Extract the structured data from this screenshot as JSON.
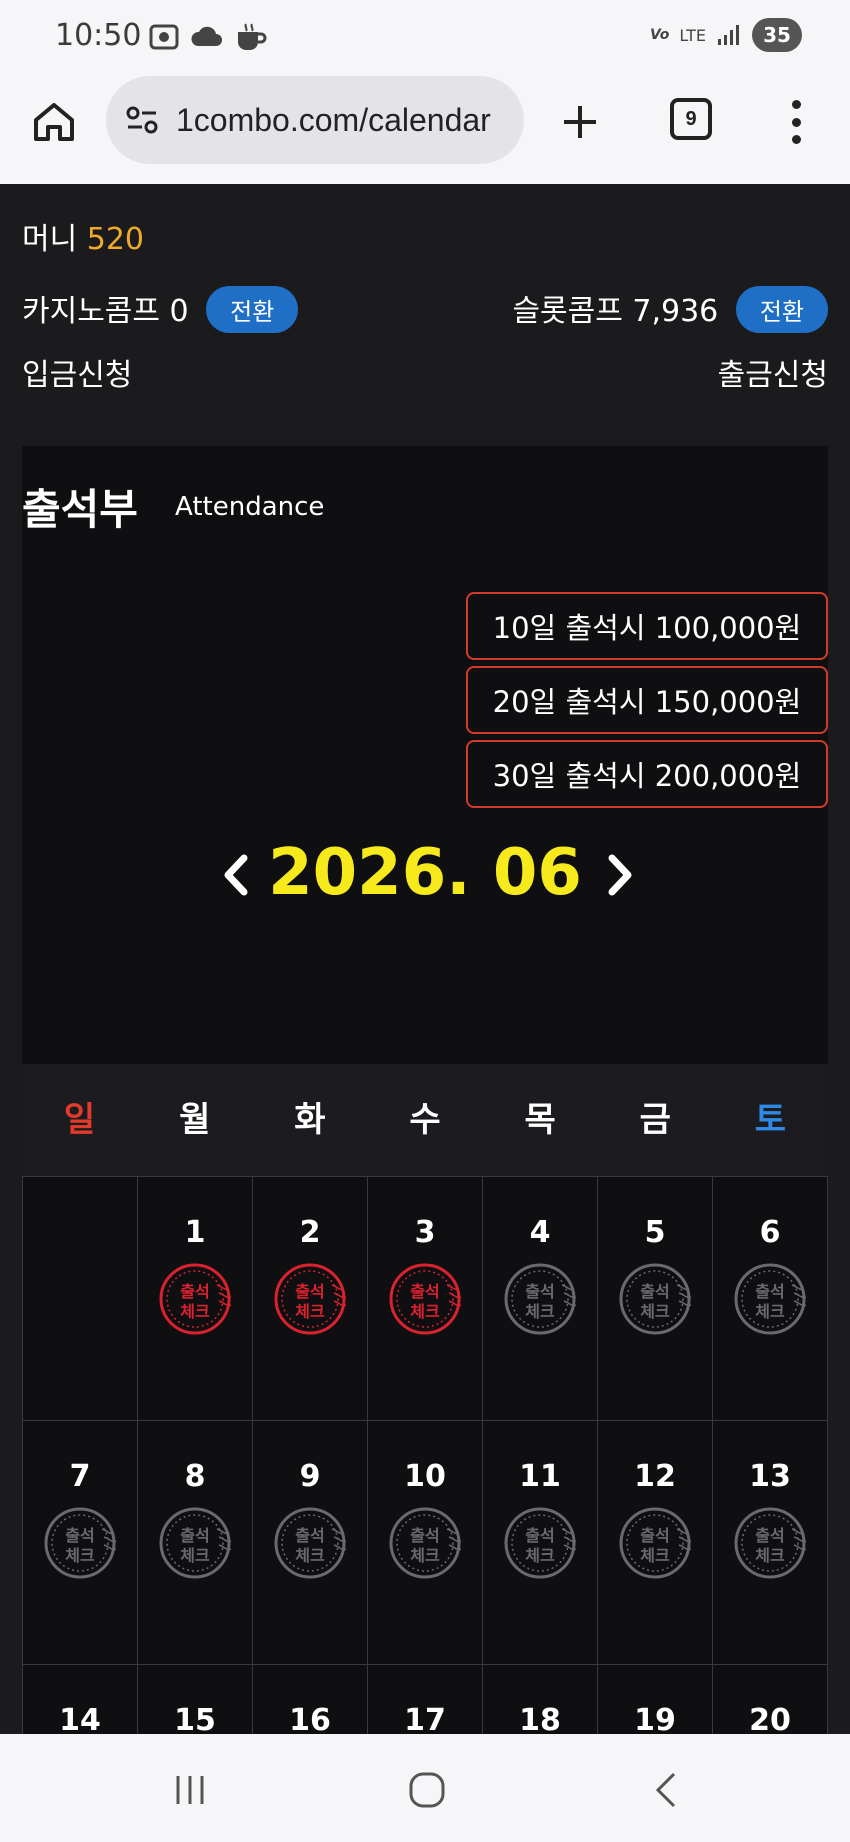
{
  "status_bar": {
    "time": "10:50",
    "network": "LTE",
    "battery": "35"
  },
  "browser": {
    "url": "1combo.com/calendar",
    "tab_count": "9"
  },
  "account": {
    "money_label": "머니",
    "money_value": "520",
    "casino_comp_label": "카지노콤프 0",
    "slot_comp_label": "슬롯콤프 7,936",
    "convert_label": "전환",
    "deposit_label": "입금신청",
    "withdraw_label": "출금신청"
  },
  "attendance": {
    "title": "출석부",
    "subtitle": "Attendance",
    "rewards": [
      "10일 출석시 100,000원",
      "20일 출석시 150,000원",
      "30일 출석시 200,000원"
    ],
    "month": "2026. 06",
    "weekdays": [
      "일",
      "월",
      "화",
      "수",
      "목",
      "금",
      "토"
    ],
    "stamp_text_line1": "출석",
    "stamp_text_line2": "체크",
    "days": [
      {
        "day": "",
        "checked": false
      },
      {
        "day": "1",
        "checked": true
      },
      {
        "day": "2",
        "checked": true
      },
      {
        "day": "3",
        "checked": true
      },
      {
        "day": "4",
        "checked": false
      },
      {
        "day": "5",
        "checked": false
      },
      {
        "day": "6",
        "checked": false
      },
      {
        "day": "7",
        "checked": false
      },
      {
        "day": "8",
        "checked": false
      },
      {
        "day": "9",
        "checked": false
      },
      {
        "day": "10",
        "checked": false
      },
      {
        "day": "11",
        "checked": false
      },
      {
        "day": "12",
        "checked": false
      },
      {
        "day": "13",
        "checked": false
      },
      {
        "day": "14",
        "checked": false
      },
      {
        "day": "15",
        "checked": false
      },
      {
        "day": "16",
        "checked": false
      },
      {
        "day": "17",
        "checked": false
      },
      {
        "day": "18",
        "checked": false
      },
      {
        "day": "19",
        "checked": false
      },
      {
        "day": "20",
        "checked": false
      }
    ]
  },
  "colors": {
    "money_value": "#f0a928",
    "month": "#f6ea1c",
    "sunday": "#e23b2b",
    "saturday": "#2e8ae6",
    "convert_button": "#1f6fc6",
    "reward_border": "#d23a2a",
    "stamp_checked": "#d9222f",
    "stamp_unchecked": "#6a6a6e"
  }
}
